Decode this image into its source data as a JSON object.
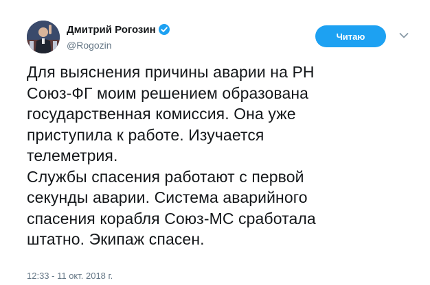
{
  "author": {
    "display_name": "Дмитрий Рогозин",
    "handle": "@Rogozin",
    "verified": true,
    "avatar_icon": "avatar-photo"
  },
  "actions": {
    "follow_label": "Читаю",
    "more_icon": "chevron-down-icon"
  },
  "tweet": {
    "lines": [
      "Для выяснения причины аварии на РН",
      "Союз-ФГ моим решением образована",
      "государственная комиссия. Она уже",
      "приступила к работе. Изучается",
      "телеметрия.",
      "Службы спасения работают с первой",
      "секунды аварии. Система аварийного",
      "спасения корабля Союз-МС сработала",
      "штатно. Экипаж спасен."
    ]
  },
  "meta": {
    "timestamp": "12:33 - 11 окт. 2018 г."
  },
  "colors": {
    "accent": "#1da1f2",
    "text": "#14171a",
    "secondary": "#657786"
  }
}
